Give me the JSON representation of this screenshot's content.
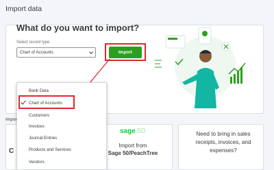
{
  "page": {
    "title": "Import data"
  },
  "hero": {
    "heading": "What do you want to import?",
    "record_type_label": "Select record type",
    "selected_value": "Chart of Accounts",
    "import_button": "Import"
  },
  "dropdown": {
    "options": [
      {
        "label": "Bank Data",
        "selected": false
      },
      {
        "label": "Chart of Accounts",
        "selected": true
      },
      {
        "label": "Customers",
        "selected": false
      },
      {
        "label": "Invoices",
        "selected": false
      },
      {
        "label": "Journal Entries",
        "selected": false
      },
      {
        "label": "Products and Services",
        "selected": false
      },
      {
        "label": "Vendors",
        "selected": false
      }
    ]
  },
  "import_section": {
    "label": "Import f",
    "left_card_letter": "C",
    "sage_card": {
      "logo": "sage",
      "logo_version": "50",
      "line1": "Import from",
      "line2": "Sage 50/PeachTree"
    },
    "receipts_card": {
      "text": "Need to bring in sales receipts, invoices, and expenses?"
    }
  },
  "colors": {
    "accent_green": "#2ca01c",
    "highlight_red": "#e3262b",
    "sage_green": "#00d639"
  },
  "icons": [
    "chevron-down-icon",
    "checkmark-icon",
    "arrow-icon",
    "person-illustration"
  ]
}
